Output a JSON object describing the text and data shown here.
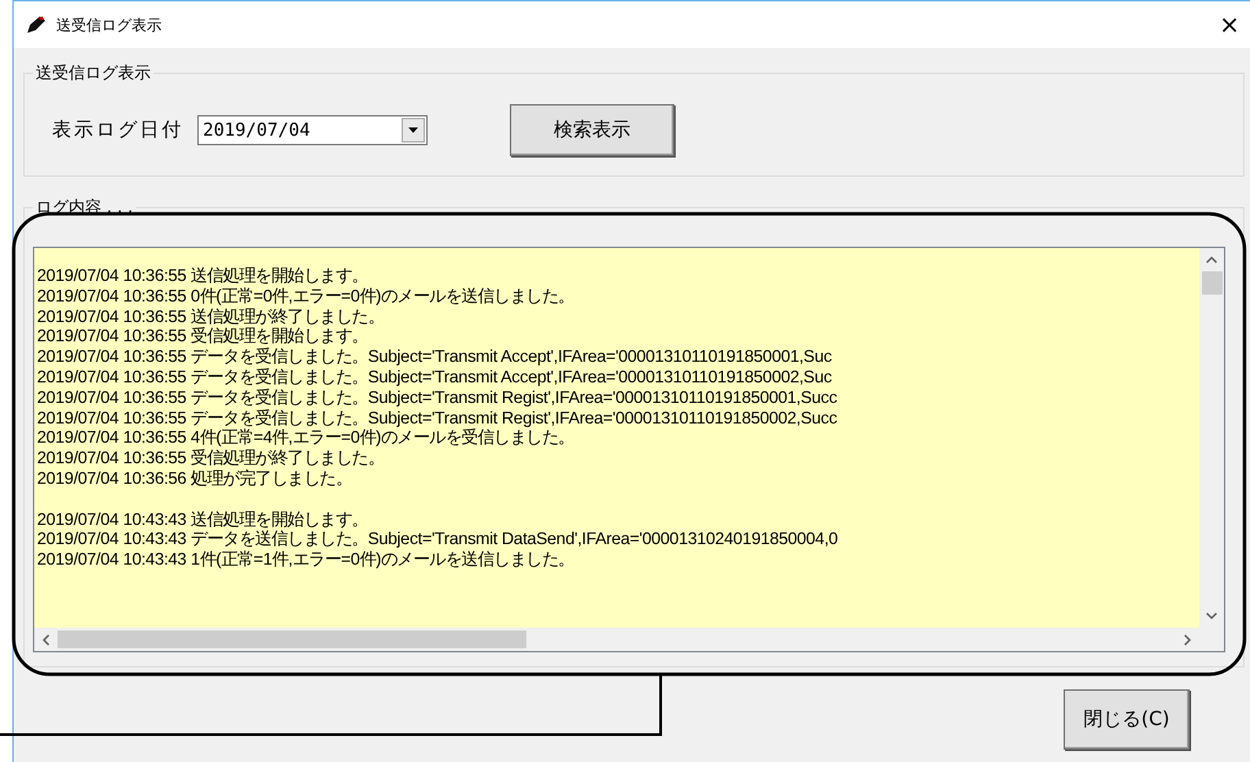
{
  "window": {
    "title": "送受信ログ表示",
    "close_glyph": "×"
  },
  "search_group": {
    "title": "送受信ログ表示",
    "date_label": "表示ログ日付",
    "date_value": "2019/07/04",
    "search_button": "検索表示"
  },
  "log_group": {
    "title": "ログ内容 . . .",
    "blocks": [
      [
        "2019/07/04 10:36:55 送信処理を開始します。",
        "2019/07/04 10:36:55 0件(正常=0件,エラー=0件)のメールを送信しました。",
        "2019/07/04 10:36:55 送信処理が終了しました。",
        "2019/07/04 10:36:55 受信処理を開始します。",
        "2019/07/04 10:36:55 データを受信しました。Subject='Transmit Accept',IFArea='00001310110191850001,Suc",
        "2019/07/04 10:36:55 データを受信しました。Subject='Transmit Accept',IFArea='00001310110191850002,Suc",
        "2019/07/04 10:36:55 データを受信しました。Subject='Transmit Regist',IFArea='00001310110191850001,Succ",
        "2019/07/04 10:36:55 データを受信しました。Subject='Transmit Regist',IFArea='00001310110191850002,Succ",
        "2019/07/04 10:36:55 4件(正常=4件,エラー=0件)のメールを受信しました。",
        "2019/07/04 10:36:55 受信処理が終了しました。",
        "2019/07/04 10:36:56 処理が完了しました。"
      ],
      [
        "2019/07/04 10:43:43 送信処理を開始します。",
        "2019/07/04 10:43:43 データを送信しました。Subject='Transmit DataSend',IFArea='00001310240191850004,0",
        "2019/07/04 10:43:43 1件(正常=1件,エラー=0件)のメールを送信しました。"
      ]
    ]
  },
  "close_button": "閉じる(C)"
}
